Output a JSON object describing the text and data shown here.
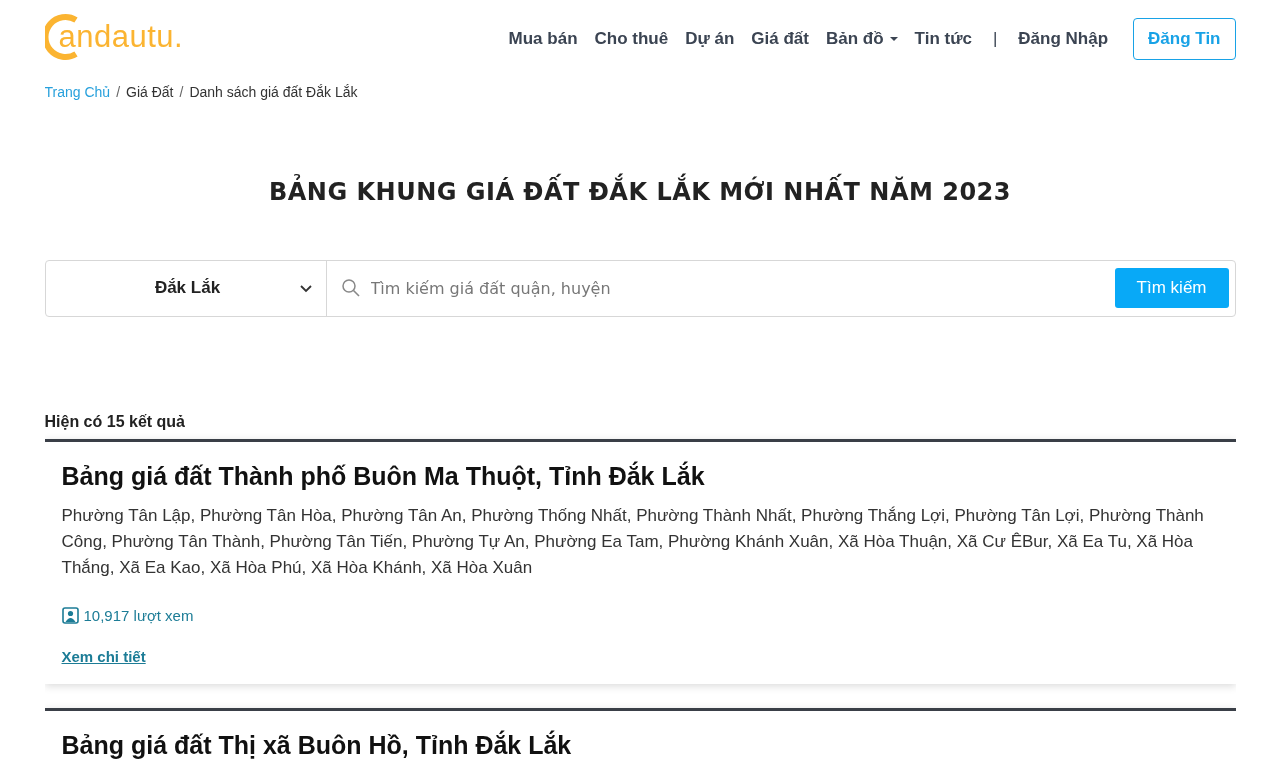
{
  "logo": {
    "text": "andautu."
  },
  "nav": {
    "items": [
      {
        "label": "Mua bán",
        "has_dropdown": false
      },
      {
        "label": "Cho thuê",
        "has_dropdown": false
      },
      {
        "label": "Dự án",
        "has_dropdown": false
      },
      {
        "label": "Giá đất",
        "has_dropdown": false
      },
      {
        "label": "Bản đồ",
        "has_dropdown": true
      },
      {
        "label": "Tin tức",
        "has_dropdown": false
      }
    ],
    "separator": "|",
    "login": "Đăng Nhập",
    "post_button": "Đăng Tin"
  },
  "breadcrumb": [
    {
      "label": "Trang Chủ",
      "kind": "link"
    },
    {
      "label": "Giá Đất",
      "kind": "text"
    },
    {
      "label": "Danh sách giá đất Đắk Lắk",
      "kind": "text"
    }
  ],
  "breadcrumb_separator": "/",
  "title": "BẢNG KHUNG GIÁ ĐẤT ĐẮK LẮK MỚI NHẤT NĂM 2023",
  "search": {
    "province": "Đắk Lắk",
    "placeholder": "Tìm kiếm giá đất quận, huyện",
    "button": "Tìm kiếm"
  },
  "results_count": "Hiện có 15 kết quả",
  "cards": [
    {
      "title": "Bảng giá đất Thành phố Buôn Ma Thuột, Tỉnh Đắk Lắk",
      "description": "Phường Tân Lập, Phường Tân Hòa, Phường Tân An, Phường Thống Nhất, Phường Thành Nhất, Phường Thắng Lợi, Phường Tân Lợi, Phường Thành Công, Phường Tân Thành, Phường Tân Tiến, Phường Tự An, Phường Ea Tam, Phường Khánh Xuân, Xã Hòa Thuận, Xã Cư ÊBur, Xã Ea Tu, Xã Hòa Thắng, Xã Ea Kao, Xã Hòa Phú, Xã Hòa Khánh, Xã Hòa Xuân",
      "views": "10,917 lượt xem",
      "link": "Xem chi tiết"
    },
    {
      "title": "Bảng giá đất Thị xã Buôn Hồ, Tỉnh Đắk Lắk"
    }
  ]
}
